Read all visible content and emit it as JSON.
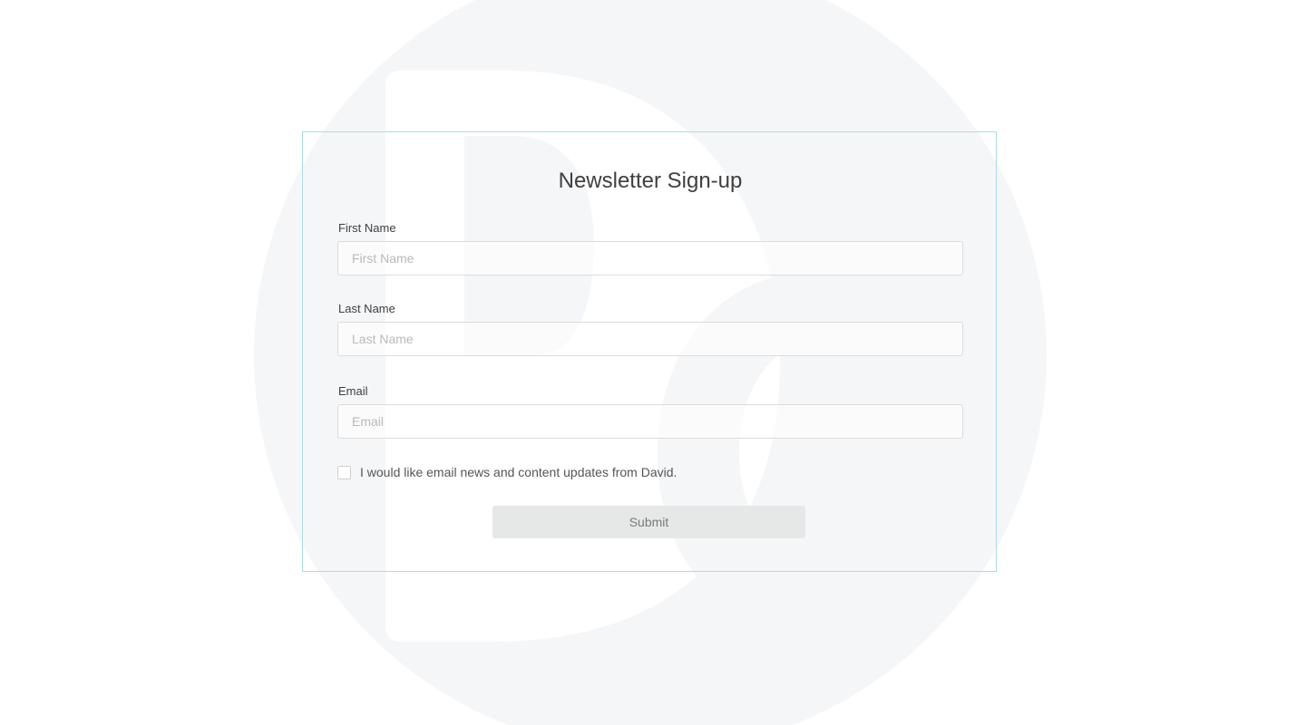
{
  "form": {
    "title": "Newsletter Sign-up",
    "first_name": {
      "label": "First Name",
      "placeholder": "First Name",
      "value": ""
    },
    "last_name": {
      "label": "Last Name",
      "placeholder": "Last Name",
      "value": ""
    },
    "email": {
      "label": "Email",
      "placeholder": "Email",
      "value": ""
    },
    "consent": {
      "label": "I would like email news and content updates from David.",
      "checked": false
    },
    "submit_label": "Submit"
  },
  "colors": {
    "card_border": "#a9dde4",
    "background_logo": "#f5f6f8",
    "submit_background": "#e6e7e7",
    "text": "#3f3f3f"
  }
}
